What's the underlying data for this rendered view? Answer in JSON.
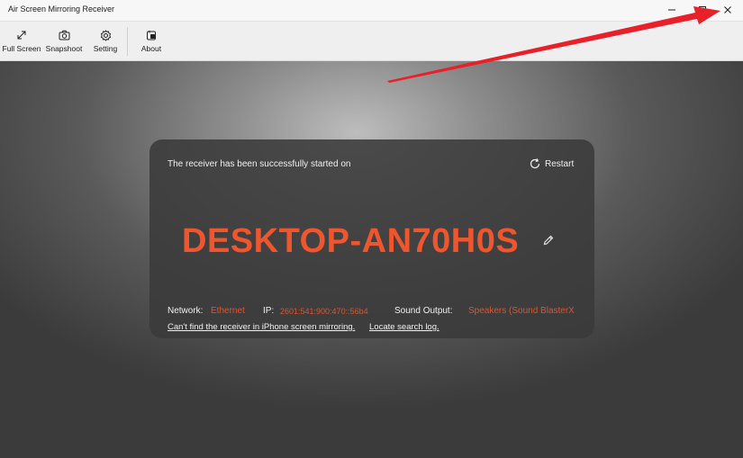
{
  "window": {
    "title": "Air Screen Mirroring Receiver",
    "minimize_icon": "minimize-icon",
    "maximize_icon": "maximize-icon",
    "close_icon": "close-icon"
  },
  "toolbar": {
    "items": [
      {
        "label": "Full Screen",
        "icon": "expand-arrows-icon"
      },
      {
        "label": "Snapshoot",
        "icon": "camera-icon"
      },
      {
        "label": "Setting",
        "icon": "gear-icon"
      },
      {
        "label": "About",
        "icon": "about-icon"
      }
    ]
  },
  "card": {
    "started_text": "The receiver has been successfully started on",
    "restart_label": "Restart",
    "device_name": "DESKTOP-AN70H0S",
    "network_label": "Network:",
    "network_value": "Ethernet",
    "ip_label": "IP:",
    "ip_value": "2601:541:900:470::56b4",
    "sound_label": "Sound Output:",
    "sound_value": "Speakers (Sound BlasterX",
    "link_cant_find": "Can't find the receiver in iPhone screen mirroring.",
    "link_log": "Locate search log."
  },
  "colors": {
    "accent": "#f0562e",
    "annotation_arrow": "#e8202a"
  }
}
